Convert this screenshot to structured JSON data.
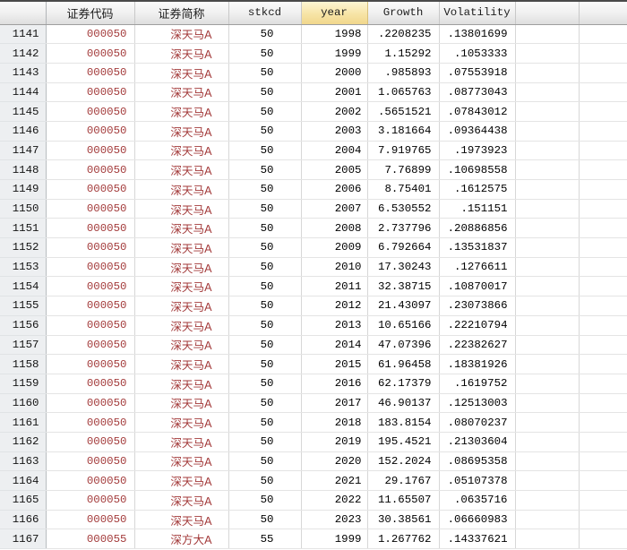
{
  "app": {
    "name": "Stata-style data editor grid",
    "selected_column": "year"
  },
  "colors": {
    "selected_header_bg": "#f3db94",
    "string_value_text": "#a33a3a",
    "rownum_column_bg": "#edeff1",
    "header_bg": "#e8e8e8",
    "grid_line": "#d7d7d7",
    "top_border": "#4a4a4a"
  },
  "columns": {
    "code": "证券代码",
    "name": "证券简称",
    "stkcd": "stkcd",
    "year": "year",
    "growth": "Growth",
    "volatility": "Volatility"
  },
  "rows": [
    {
      "n": "1141",
      "code": "000050",
      "name": "深天马A",
      "stkcd": "50",
      "year": "1998",
      "growth": ".2208235",
      "volatility": ".13801699"
    },
    {
      "n": "1142",
      "code": "000050",
      "name": "深天马A",
      "stkcd": "50",
      "year": "1999",
      "growth": "1.15292",
      "volatility": ".1053333"
    },
    {
      "n": "1143",
      "code": "000050",
      "name": "深天马A",
      "stkcd": "50",
      "year": "2000",
      "growth": ".985893",
      "volatility": ".07553918"
    },
    {
      "n": "1144",
      "code": "000050",
      "name": "深天马A",
      "stkcd": "50",
      "year": "2001",
      "growth": "1.065763",
      "volatility": ".08773043"
    },
    {
      "n": "1145",
      "code": "000050",
      "name": "深天马A",
      "stkcd": "50",
      "year": "2002",
      "growth": ".5651521",
      "volatility": ".07843012"
    },
    {
      "n": "1146",
      "code": "000050",
      "name": "深天马A",
      "stkcd": "50",
      "year": "2003",
      "growth": "3.181664",
      "volatility": ".09364438"
    },
    {
      "n": "1147",
      "code": "000050",
      "name": "深天马A",
      "stkcd": "50",
      "year": "2004",
      "growth": "7.919765",
      "volatility": ".1973923"
    },
    {
      "n": "1148",
      "code": "000050",
      "name": "深天马A",
      "stkcd": "50",
      "year": "2005",
      "growth": "7.76899",
      "volatility": ".10698558"
    },
    {
      "n": "1149",
      "code": "000050",
      "name": "深天马A",
      "stkcd": "50",
      "year": "2006",
      "growth": "8.75401",
      "volatility": ".1612575"
    },
    {
      "n": "1150",
      "code": "000050",
      "name": "深天马A",
      "stkcd": "50",
      "year": "2007",
      "growth": "6.530552",
      "volatility": ".151151"
    },
    {
      "n": "1151",
      "code": "000050",
      "name": "深天马A",
      "stkcd": "50",
      "year": "2008",
      "growth": "2.737796",
      "volatility": ".20886856"
    },
    {
      "n": "1152",
      "code": "000050",
      "name": "深天马A",
      "stkcd": "50",
      "year": "2009",
      "growth": "6.792664",
      "volatility": ".13531837"
    },
    {
      "n": "1153",
      "code": "000050",
      "name": "深天马A",
      "stkcd": "50",
      "year": "2010",
      "growth": "17.30243",
      "volatility": ".1276611"
    },
    {
      "n": "1154",
      "code": "000050",
      "name": "深天马A",
      "stkcd": "50",
      "year": "2011",
      "growth": "32.38715",
      "volatility": ".10870017"
    },
    {
      "n": "1155",
      "code": "000050",
      "name": "深天马A",
      "stkcd": "50",
      "year": "2012",
      "growth": "21.43097",
      "volatility": ".23073866"
    },
    {
      "n": "1156",
      "code": "000050",
      "name": "深天马A",
      "stkcd": "50",
      "year": "2013",
      "growth": "10.65166",
      "volatility": ".22210794"
    },
    {
      "n": "1157",
      "code": "000050",
      "name": "深天马A",
      "stkcd": "50",
      "year": "2014",
      "growth": "47.07396",
      "volatility": ".22382627"
    },
    {
      "n": "1158",
      "code": "000050",
      "name": "深天马A",
      "stkcd": "50",
      "year": "2015",
      "growth": "61.96458",
      "volatility": ".18381926"
    },
    {
      "n": "1159",
      "code": "000050",
      "name": "深天马A",
      "stkcd": "50",
      "year": "2016",
      "growth": "62.17379",
      "volatility": ".1619752"
    },
    {
      "n": "1160",
      "code": "000050",
      "name": "深天马A",
      "stkcd": "50",
      "year": "2017",
      "growth": "46.90137",
      "volatility": ".12513003"
    },
    {
      "n": "1161",
      "code": "000050",
      "name": "深天马A",
      "stkcd": "50",
      "year": "2018",
      "growth": "183.8154",
      "volatility": ".08070237"
    },
    {
      "n": "1162",
      "code": "000050",
      "name": "深天马A",
      "stkcd": "50",
      "year": "2019",
      "growth": "195.4521",
      "volatility": ".21303604"
    },
    {
      "n": "1163",
      "code": "000050",
      "name": "深天马A",
      "stkcd": "50",
      "year": "2020",
      "growth": "152.2024",
      "volatility": ".08695358"
    },
    {
      "n": "1164",
      "code": "000050",
      "name": "深天马A",
      "stkcd": "50",
      "year": "2021",
      "growth": "29.1767",
      "volatility": ".05107378"
    },
    {
      "n": "1165",
      "code": "000050",
      "name": "深天马A",
      "stkcd": "50",
      "year": "2022",
      "growth": "11.65507",
      "volatility": ".0635716"
    },
    {
      "n": "1166",
      "code": "000050",
      "name": "深天马A",
      "stkcd": "50",
      "year": "2023",
      "growth": "30.38561",
      "volatility": ".06660983"
    },
    {
      "n": "1167",
      "code": "000055",
      "name": "深方大A",
      "stkcd": "55",
      "year": "1999",
      "growth": "1.267762",
      "volatility": ".14337621"
    }
  ]
}
